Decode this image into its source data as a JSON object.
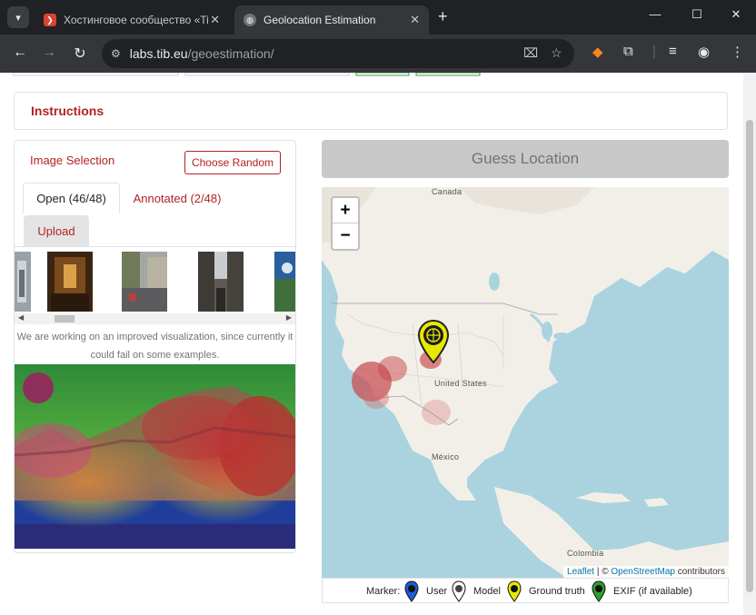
{
  "browser": {
    "tabs": [
      {
        "title": "Хостинговое сообщество «Tim",
        "active": false
      },
      {
        "title": "Geolocation Estimation",
        "active": true
      }
    ],
    "url_host": "labs.tib.eu",
    "url_path": "/geoestimation/",
    "window_controls": [
      "minimize-icon",
      "maximize-icon",
      "close-icon"
    ]
  },
  "page": {
    "instructions": "Instructions",
    "image_selection": {
      "title": "Image Selection",
      "choose_random": "Choose Random",
      "tabs": [
        "Open (46/48)",
        "Annotated (2/48)",
        "Upload"
      ],
      "note": "We are working on an improved visualization, since currently it could fail on some examples."
    },
    "guess_location": "Guess Location",
    "map": {
      "zoom_in": "+",
      "zoom_out": "−",
      "labels": {
        "canada": "Canada",
        "us": "United States",
        "mexico": "México",
        "colombia": "Colombia"
      },
      "attribution": {
        "leaflet": "Leaflet",
        "sep": " | © ",
        "osm": "OpenStreetMap",
        "contrib": " contributors"
      }
    },
    "legend": {
      "label": "Marker:",
      "items": [
        "User",
        "Model",
        "Ground truth",
        "EXIF (if available)"
      ],
      "colors": {
        "user": "#1a5fd6",
        "model": "#444444",
        "ground_truth": "#e8e800",
        "exif": "#2ca02c"
      }
    }
  }
}
